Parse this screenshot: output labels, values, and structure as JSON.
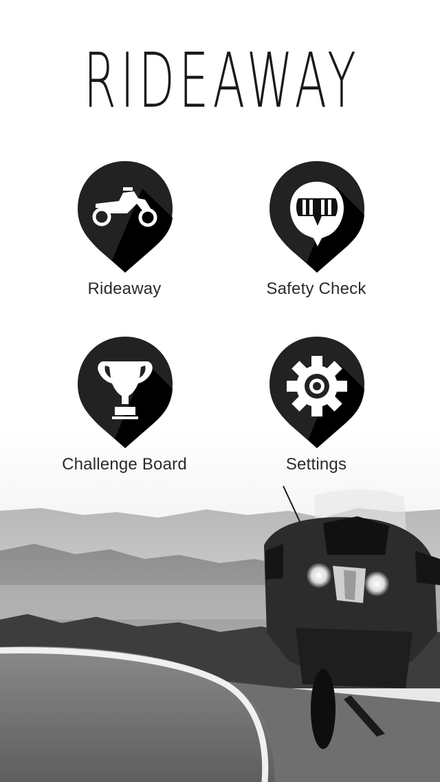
{
  "app": {
    "title": "RIDEAWAY"
  },
  "menu": {
    "items": [
      {
        "label": "Rideaway",
        "icon": "motorcycle-icon"
      },
      {
        "label": "Safety Check",
        "icon": "helmet-icon"
      },
      {
        "label": "Challenge Board",
        "icon": "trophy-icon"
      },
      {
        "label": "Settings",
        "icon": "gear-icon"
      }
    ]
  },
  "colors": {
    "pin": "#222222",
    "pin_shadow": "#000000",
    "label": "#2b2b2b",
    "background": "#ffffff"
  }
}
